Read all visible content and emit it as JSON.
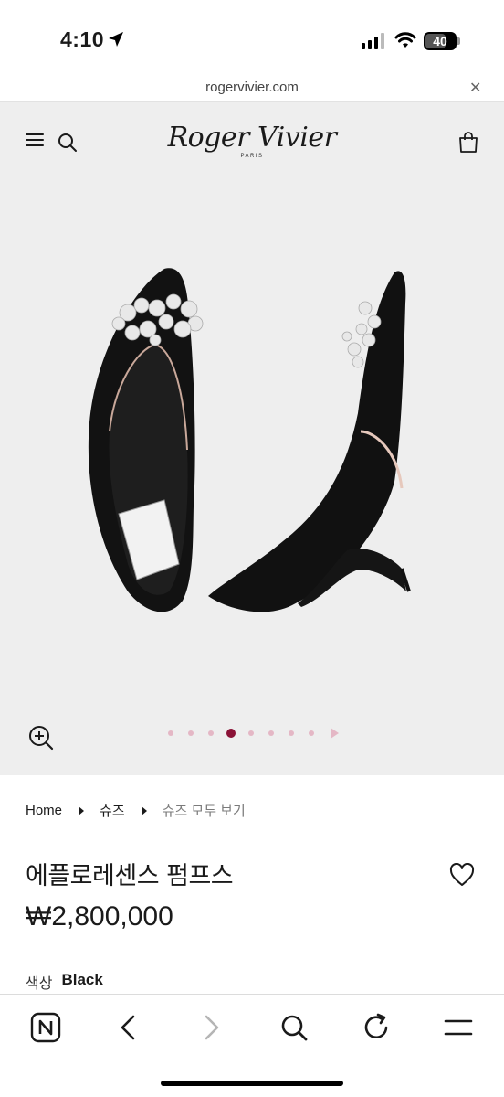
{
  "status_bar": {
    "time": "4:10",
    "battery": "40"
  },
  "browser": {
    "url": "rogervivier.com"
  },
  "site": {
    "brand": "Roger Vivier",
    "brand_sub": "PARIS"
  },
  "gallery": {
    "dots_total": 8,
    "active_index": 3
  },
  "breadcrumb": {
    "home": "Home",
    "category": "슈즈",
    "current": "슈즈 모두 보기"
  },
  "product": {
    "title": "에플로레센스 펌프스",
    "price": "₩2,800,000",
    "color_label": "색상",
    "color_value": "Black"
  },
  "colors": {
    "accent": "#8a1236",
    "dot_inactive": "#e4b7c5",
    "hero_bg": "#eeeeee"
  }
}
